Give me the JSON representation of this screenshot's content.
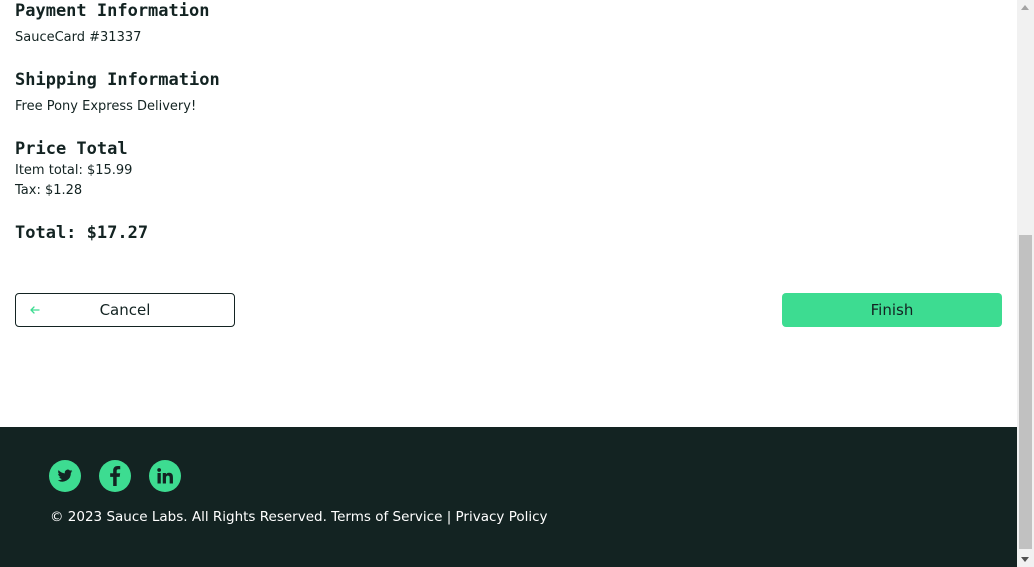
{
  "payment": {
    "heading": "Payment Information",
    "value": "SauceCard #31337"
  },
  "shipping": {
    "heading": "Shipping Information",
    "value": "Free Pony Express Delivery!"
  },
  "price": {
    "heading": "Price Total",
    "item_total": "Item total: $15.99",
    "tax": "Tax: $1.28",
    "total": "Total: $17.27"
  },
  "buttons": {
    "cancel": "Cancel",
    "finish": "Finish",
    "cancel_icon": "arrow-left-icon"
  },
  "footer": {
    "social": [
      "twitter-icon",
      "facebook-icon",
      "linkedin-icon"
    ],
    "copyright": "© 2023 Sauce Labs. All Rights Reserved. Terms of Service | Privacy Policy"
  },
  "colors": {
    "accent": "#3ddc91",
    "dark": "#132322",
    "text": "#132322"
  }
}
